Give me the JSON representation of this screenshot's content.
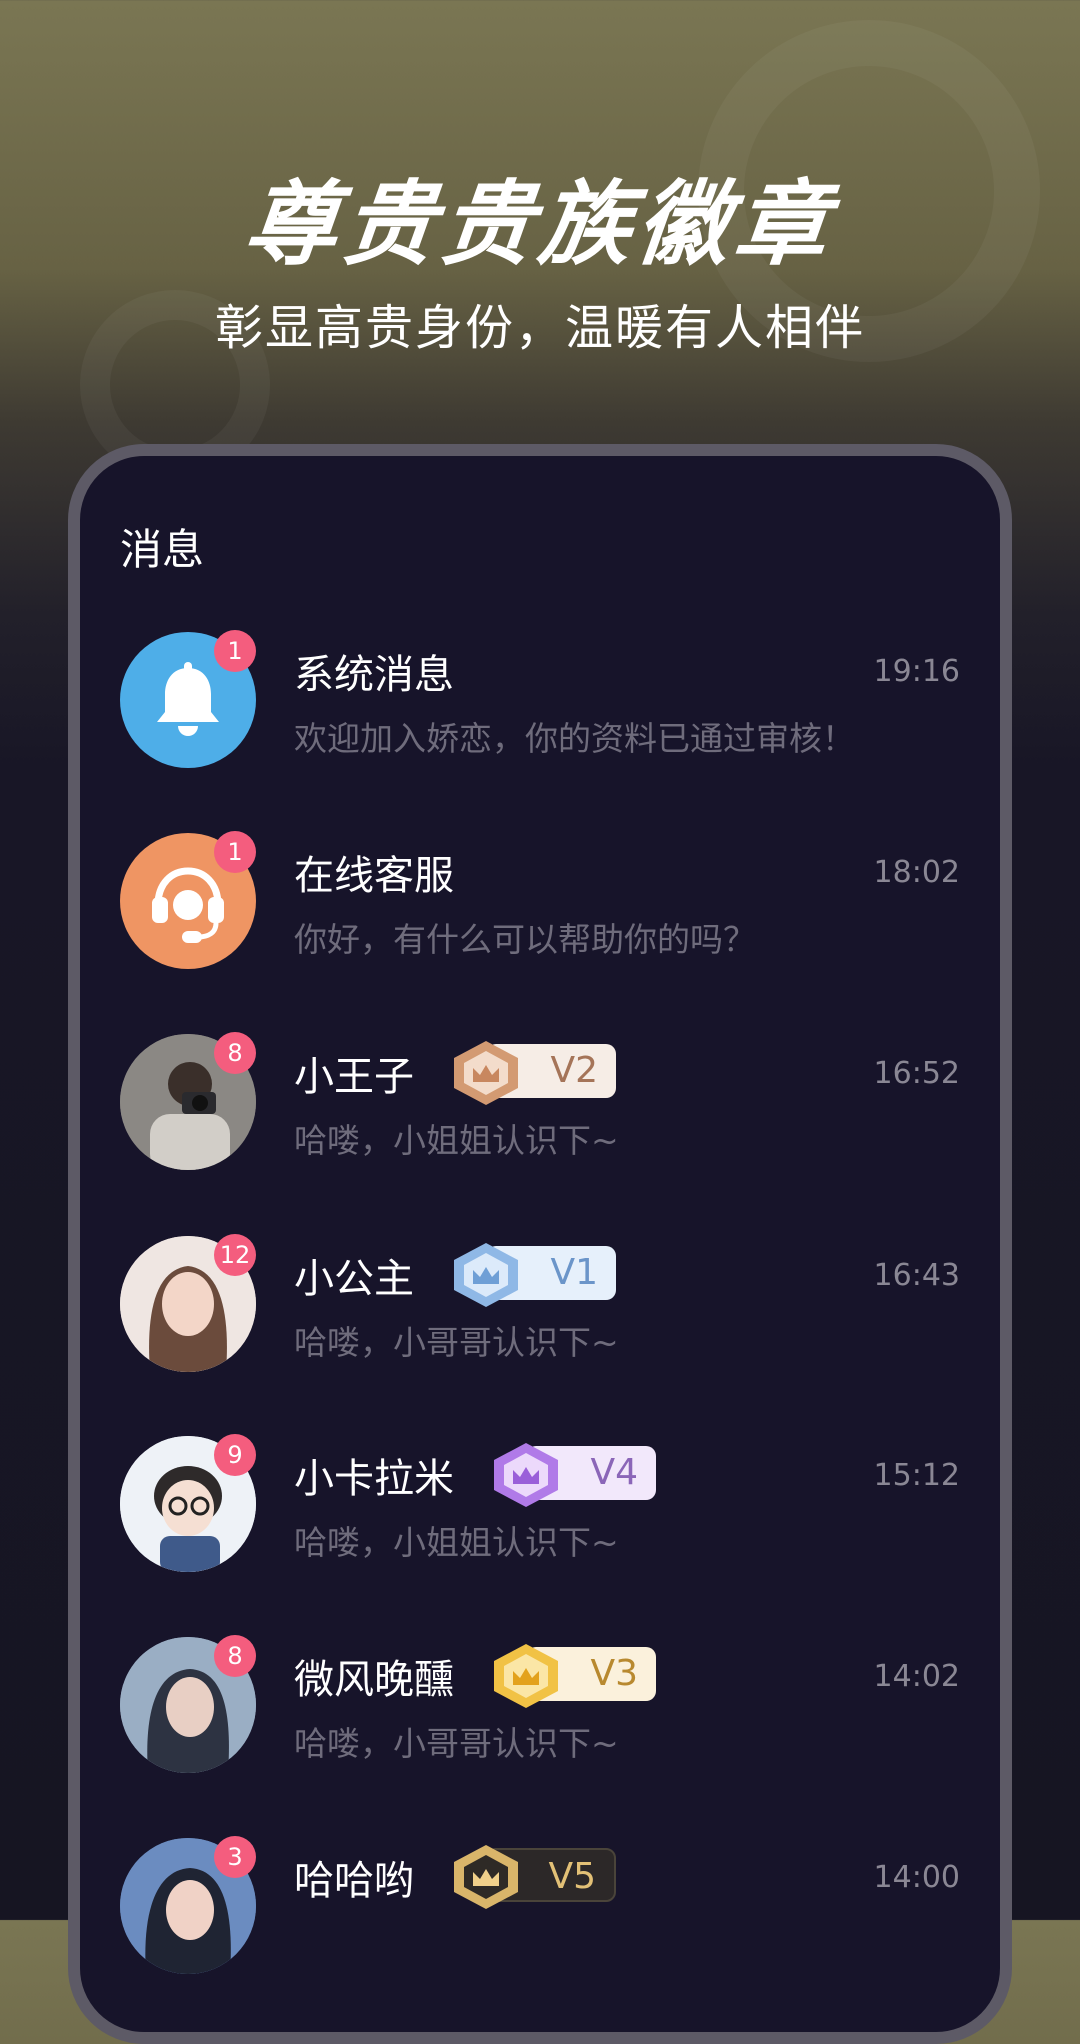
{
  "headline": "尊贵贵族徽章",
  "subheadline": "彰显高贵身份，温暖有人相伴",
  "panel_title": "消息",
  "conversations": [
    {
      "name": "系统消息",
      "time": "19:16",
      "preview": "欢迎加入娇恋，你的资料已通过审核！",
      "unread": "1",
      "avatar": "bell-icon",
      "avatar_color": "#4eaee8"
    },
    {
      "name": "在线客服",
      "time": "18:02",
      "preview": "你好，有什么可以帮助你的吗？",
      "unread": "1",
      "avatar": "headset-icon",
      "avatar_color": "#ef9563"
    },
    {
      "name": "小王子",
      "time": "16:52",
      "preview": "哈喽，小姐姐认识下~",
      "unread": "8",
      "vip": "V2",
      "vip_color": "#d39a72",
      "vip_bg": "#f6ede6",
      "vip_text": "#a57458"
    },
    {
      "name": "小公主",
      "time": "16:43",
      "preview": "哈喽，小哥哥认识下~",
      "unread": "12",
      "vip": "V1",
      "vip_color": "#8fb8e6",
      "vip_bg": "#e6f0fb",
      "vip_text": "#6b95c9"
    },
    {
      "name": "小卡拉米",
      "time": "15:12",
      "preview": "哈喽，小姐姐认识下~",
      "unread": "9",
      "vip": "V4",
      "vip_color": "#b07ae8",
      "vip_bg": "#f2e8fb",
      "vip_text": "#8b66b8"
    },
    {
      "name": "微风晚醺",
      "time": "14:02",
      "preview": "哈喽，小哥哥认识下~",
      "unread": "8",
      "vip": "V3",
      "vip_color": "#f1c245",
      "vip_bg": "#fbf1dc",
      "vip_text": "#b8892f"
    },
    {
      "name": "哈哈哟",
      "time": "14:00",
      "preview": "",
      "unread": "3",
      "vip": "V5",
      "vip_color": "#d9b56a",
      "vip_bg": "#2c2828",
      "vip_text": "#e2c076"
    }
  ]
}
